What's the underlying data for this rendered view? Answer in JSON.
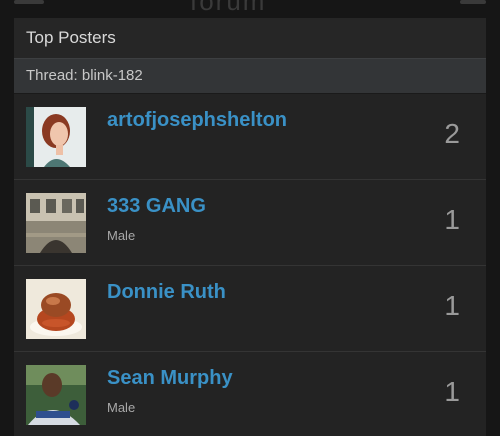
{
  "header": {
    "title": "Top Posters"
  },
  "thread": {
    "label": "Thread: blink-182"
  },
  "posters": [
    {
      "name": "artofjosephshelton",
      "subtitle": "",
      "count": "2",
      "avatar": "portrait-redhead"
    },
    {
      "name": "333 GANG",
      "subtitle": "Male",
      "count": "1",
      "avatar": "building-photo"
    },
    {
      "name": "Donnie Ruth",
      "subtitle": "",
      "count": "1",
      "avatar": "food-photo"
    },
    {
      "name": "Sean Murphy",
      "subtitle": "Male",
      "count": "1",
      "avatar": "baseball-player-photo"
    }
  ]
}
